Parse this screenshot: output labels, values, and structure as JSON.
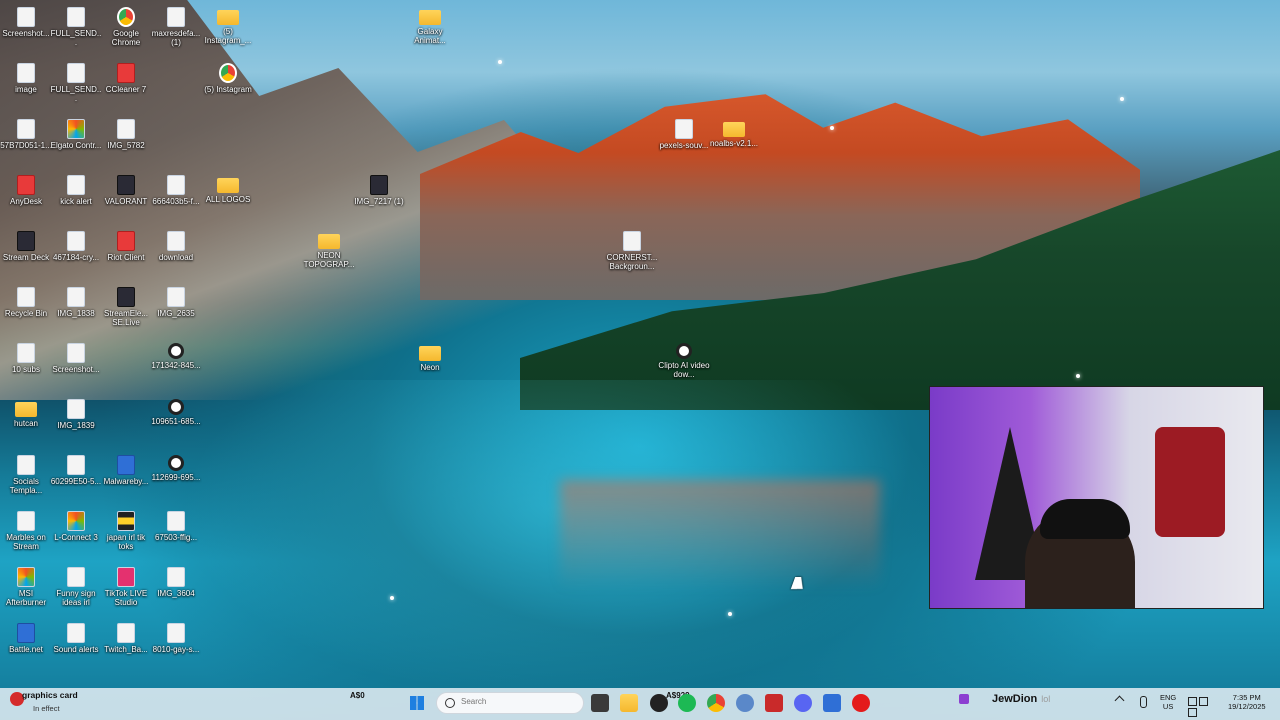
{
  "desktop": {
    "icons": [
      {
        "label": "Screenshot...",
        "icon": "image-file-icon",
        "type": "file"
      },
      {
        "label": "FULL_SEND...",
        "icon": "image-file-icon",
        "type": "file"
      },
      {
        "label": "Google Chrome",
        "icon": "chrome-icon",
        "type": "app-chrome"
      },
      {
        "label": "maxresdefa... (1)",
        "icon": "image-file-icon",
        "type": "file"
      },
      {
        "label": "(5) Instagram_...",
        "icon": "folder-icon",
        "type": "folder"
      },
      {
        "label": "Galaxy Animat...",
        "icon": "folder-icon",
        "type": "folder"
      },
      {
        "label": "image",
        "icon": "image-file-icon",
        "type": "file"
      },
      {
        "label": "FULL_SEND...",
        "icon": "image-file-icon",
        "type": "file"
      },
      {
        "label": "CCleaner 7",
        "icon": "ccleaner-icon",
        "type": "app-red"
      },
      {
        "label": "(5) Instagram",
        "icon": "chrome-shortcut-icon",
        "type": "app-chrome"
      },
      {
        "label": "57B7D051-1...",
        "icon": "image-file-icon",
        "type": "file"
      },
      {
        "label": "Elgato Contr...",
        "icon": "elgato-icon",
        "type": "app-rainbow"
      },
      {
        "label": "IMG_5782",
        "icon": "image-file-icon",
        "type": "file"
      },
      {
        "label": "pexels-souv...",
        "icon": "image-file-icon",
        "type": "file"
      },
      {
        "label": "noalbs-v2.1...",
        "icon": "folder-icon",
        "type": "folder"
      },
      {
        "label": "AnyDesk",
        "icon": "anydesk-icon",
        "type": "app-red"
      },
      {
        "label": "kick alert",
        "icon": "text-file-icon",
        "type": "file"
      },
      {
        "label": "VALORANT",
        "icon": "valorant-icon",
        "type": "app-dark"
      },
      {
        "label": "666403b5-f...",
        "icon": "image-file-icon",
        "type": "file"
      },
      {
        "label": "ALL LOGOS",
        "icon": "folder-icon",
        "type": "folder"
      },
      {
        "label": "IMG_7217 (1)",
        "icon": "image-file-icon",
        "type": "app-dark"
      },
      {
        "label": "Stream Deck",
        "icon": "stream-deck-icon",
        "type": "app-dark"
      },
      {
        "label": "467184-cry...",
        "icon": "image-file-icon",
        "type": "file"
      },
      {
        "label": "Riot Client",
        "icon": "riot-client-icon",
        "type": "app-red"
      },
      {
        "label": "download",
        "icon": "image-file-icon",
        "type": "file"
      },
      {
        "label": "NEON TOPOGRAP...",
        "icon": "folder-icon",
        "type": "folder"
      },
      {
        "label": "CORNERST... Backgroun...",
        "icon": "image-file-icon",
        "type": "file"
      },
      {
        "label": "Recycle Bin",
        "icon": "recycle-bin-icon",
        "type": "file"
      },
      {
        "label": "IMG_1838",
        "icon": "image-file-icon",
        "type": "file"
      },
      {
        "label": "StreamEle... SE.Live",
        "icon": "streamelements-icon",
        "type": "app-dark"
      },
      {
        "label": "IMG_2635",
        "icon": "image-file-icon",
        "type": "file"
      },
      {
        "label": "10 subs",
        "icon": "text-file-icon",
        "type": "file"
      },
      {
        "label": "Screenshot...",
        "icon": "image-file-icon",
        "type": "file"
      },
      {
        "label": "171342-845...",
        "icon": "video-file-icon",
        "type": "app-video"
      },
      {
        "label": "Neon",
        "icon": "folder-icon",
        "type": "folder"
      },
      {
        "label": "Clipto AI video dow...",
        "icon": "video-file-icon",
        "type": "app-video"
      },
      {
        "label": "hutcan",
        "icon": "folder-icon",
        "type": "folder"
      },
      {
        "label": "IMG_1839",
        "icon": "image-file-icon",
        "type": "file"
      },
      {
        "label": "109651-685...",
        "icon": "video-file-icon",
        "type": "app-video"
      },
      {
        "label": "Socials Templa...",
        "icon": "image-file-icon",
        "type": "file"
      },
      {
        "label": "60299E50-5...",
        "icon": "image-file-icon",
        "type": "file"
      },
      {
        "label": "Malwareby...",
        "icon": "malwarebytes-icon",
        "type": "app-blue"
      },
      {
        "label": "112699-695...",
        "icon": "video-file-icon",
        "type": "app-video"
      },
      {
        "label": "Marbles on Stream",
        "icon": "marbles-icon",
        "type": "file"
      },
      {
        "label": "L-Connect 3",
        "icon": "l-connect-icon",
        "type": "app-rainbow"
      },
      {
        "label": "japan irl tik toks",
        "icon": "japan-folder-icon",
        "type": "app-yellow"
      },
      {
        "label": "67503-ffig...",
        "icon": "image-file-icon",
        "type": "file"
      },
      {
        "label": "MSI Afterburner",
        "icon": "msi-afterburner-icon",
        "type": "app-rainbow"
      },
      {
        "label": "Funny sign ideas irl",
        "icon": "text-file-icon",
        "type": "file"
      },
      {
        "label": "TikTok LIVE Studio",
        "icon": "tiktok-live-icon",
        "type": "app-pink"
      },
      {
        "label": "IMG_3604",
        "icon": "image-file-icon",
        "type": "file"
      },
      {
        "label": "Battle.net",
        "icon": "battlenet-icon",
        "type": "app-blue"
      },
      {
        "label": "Sound alerts",
        "icon": "text-file-icon",
        "type": "file"
      },
      {
        "label": "Twitch_Ba...",
        "icon": "image-file-icon",
        "type": "file"
      },
      {
        "label": "8010-gay-s...",
        "icon": "image-file-icon",
        "type": "file"
      }
    ]
  },
  "stock_widget": {
    "title": "graphics card",
    "status": "In effect",
    "amount_left": "A$0",
    "amount_right": "A$929"
  },
  "taskbar": {
    "search_placeholder": "Search",
    "channel_name": "JewDion",
    "channel_tag": "lol",
    "language": "ENG",
    "region": "US",
    "time": "7:35 PM",
    "date": "19/12/2025",
    "accent": "#1e7fe0"
  }
}
